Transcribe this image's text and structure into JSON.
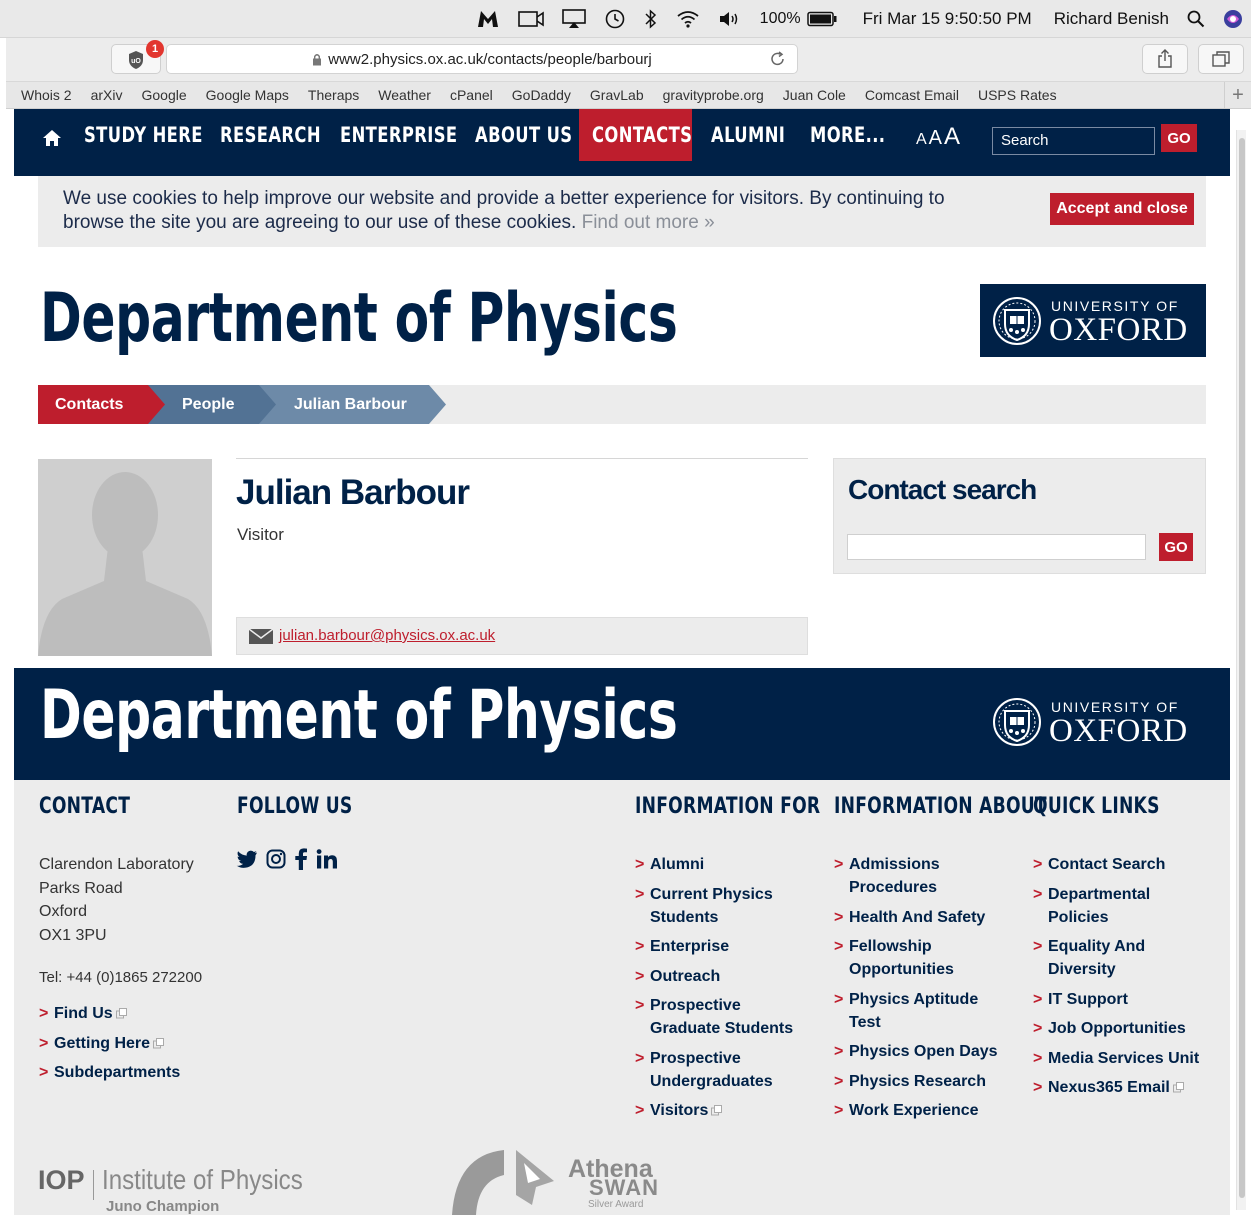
{
  "menubar": {
    "battery": "100%",
    "datetime": "Fri Mar 15  9:50:50 PM",
    "user": "Richard Benish"
  },
  "browser": {
    "badge_count": "1",
    "url": "www2.physics.ox.ac.uk/contacts/people/barbourj",
    "bookmarks": [
      "Whois 2",
      "arXiv",
      "Google",
      "Google Maps",
      "Theraps",
      "Weather",
      "cPanel",
      "GoDaddy",
      "GravLab",
      "gravityprobe.org",
      "Juan Cole",
      "Comcast Email",
      "USPS Rates"
    ]
  },
  "nav": {
    "items": [
      "STUDY HERE",
      "RESEARCH",
      "ENTERPRISE",
      "ABOUT US",
      "CONTACTS",
      "ALUMNI",
      "MORE..."
    ],
    "active": "CONTACTS",
    "font_sizes": [
      "A",
      "A",
      "A"
    ],
    "search_placeholder": "Search",
    "go_label": "GO"
  },
  "cookie": {
    "text": "We use cookies to help improve our website and provide a better experience for visitors. By continuing to browse the site you are agreeing to our use of these cookies.",
    "more_link": "Find out more »",
    "accept_label": "Accept and close"
  },
  "header": {
    "title": "Department of Physics",
    "logo_top": "UNIVERSITY OF",
    "logo_main": "OXFORD"
  },
  "breadcrumb": [
    "Contacts",
    "People",
    "Julian Barbour"
  ],
  "person": {
    "name": "Julian Barbour",
    "role": "Visitor",
    "email": "julian.barbour@physics.ox.ac.uk"
  },
  "contact_search": {
    "title": "Contact search",
    "go_label": "GO"
  },
  "footer": {
    "title": "Department of Physics",
    "logo_top": "UNIVERSITY OF",
    "logo_main": "OXFORD",
    "contact": {
      "heading": "CONTACT",
      "address": [
        "Clarendon Laboratory",
        "Parks Road",
        "Oxford",
        "OX1 3PU"
      ],
      "tel": "Tel: +44 (0)1865 272200",
      "links": [
        "Find Us",
        "Getting Here",
        "Subdepartments"
      ]
    },
    "follow": {
      "heading": "FOLLOW US",
      "icons": [
        "twitter-icon",
        "instagram-icon",
        "facebook-icon",
        "linkedin-icon"
      ]
    },
    "info_for": {
      "heading": "INFORMATION FOR",
      "links": [
        "Alumni",
        "Current Physics Students",
        "Enterprise",
        "Outreach",
        "Prospective Graduate Students",
        "Prospective Undergraduates",
        "Visitors"
      ]
    },
    "info_about": {
      "heading": "INFORMATION ABOUT",
      "links": [
        "Admissions Procedures",
        "Health And Safety",
        "Fellowship Opportunities",
        "Physics Aptitude Test",
        "Physics Open Days",
        "Physics Research",
        "Work Experience"
      ]
    },
    "quick_links": {
      "heading": "QUICK LINKS",
      "links": [
        "Contact Search",
        "Departmental Policies",
        "Equality And Diversity",
        "IT Support",
        "Job Opportunities",
        "Media Services Unit",
        "Nexus365 Email"
      ]
    },
    "iop": {
      "abbr": "IOP",
      "name": "Institute of Physics",
      "award": "Juno Champion"
    },
    "athena": {
      "name": "Athena",
      "swan": "SWAN",
      "award": "Silver Award"
    }
  },
  "colors": {
    "oxford_blue": "#002147",
    "accent_red": "#be1e2d",
    "panel_grey": "#ececec"
  }
}
